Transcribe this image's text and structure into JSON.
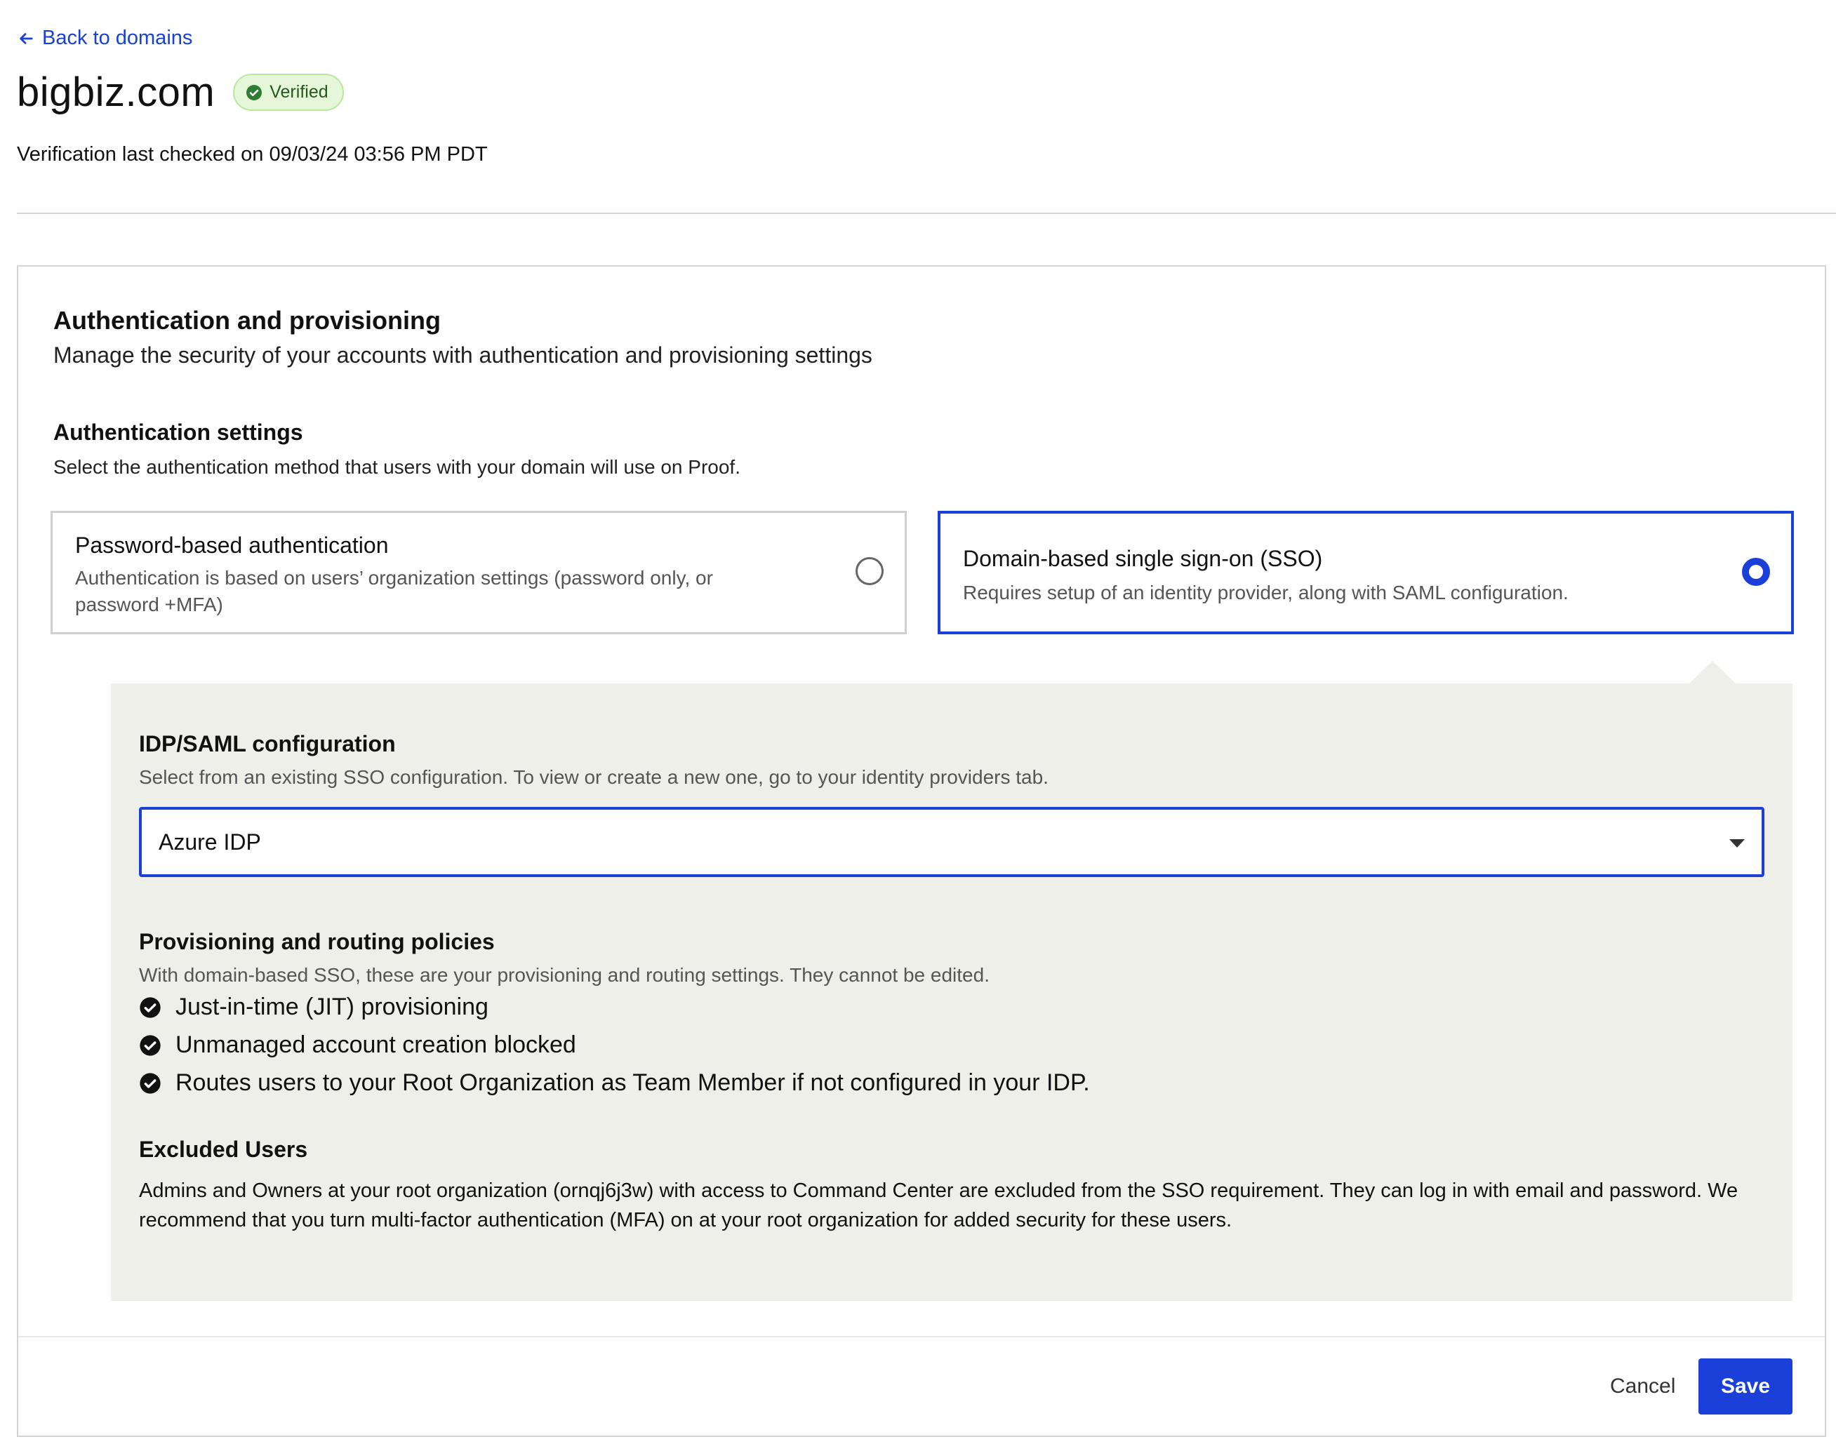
{
  "nav": {
    "back_label": "Back to domains"
  },
  "header": {
    "domain": "bigbiz.com",
    "status_badge": "Verified",
    "verification_text": "Verification last checked on 09/03/24 03:56 PM PDT"
  },
  "section": {
    "title": "Authentication and provisioning",
    "subtitle": "Manage the security of your accounts with authentication and provisioning settings"
  },
  "auth_settings": {
    "title": "Authentication settings",
    "subtitle": "Select the authentication method that users with your domain will use on Proof.",
    "options": [
      {
        "title": "Password-based authentication",
        "description": "Authentication is based on users’ organization settings (password only, or password +MFA)",
        "selected": false
      },
      {
        "title": "Domain-based single sign-on (SSO)",
        "description": "Requires setup of an identity provider, along with SAML configuration.",
        "selected": true
      }
    ]
  },
  "idp": {
    "title": "IDP/SAML configuration",
    "subtitle": "Select from an existing SSO configuration. To view or create a new one, go to your identity providers tab.",
    "selected_value": "Azure IDP"
  },
  "provisioning": {
    "title": "Provisioning and routing policies",
    "subtitle": "With domain-based SSO, these are your provisioning and routing settings. They cannot be edited.",
    "policies": [
      "Just-in-time (JIT) provisioning",
      "Unmanaged account creation blocked",
      "Routes users to your Root Organization as Team Member if not configured in your IDP."
    ]
  },
  "excluded": {
    "title": "Excluded Users",
    "text": "Admins and Owners at your root organization (ornqj6j3w) with access to Command Center are excluded from the SSO requirement. They can log in with email and password. We recommend that you turn multi-factor authentication (MFA) on at your root organization for added security for these users."
  },
  "footer": {
    "cancel_label": "Cancel",
    "save_label": "Save"
  },
  "colors": {
    "accent": "#1a40d9",
    "panel_bg": "#efefea",
    "badge_bg": "#e5f7d8",
    "badge_text": "#245a1a"
  },
  "icons": {
    "back": "arrow-left-icon",
    "verified": "check-circle-icon",
    "policy": "check-circle-filled-icon",
    "select": "caret-down-icon"
  }
}
